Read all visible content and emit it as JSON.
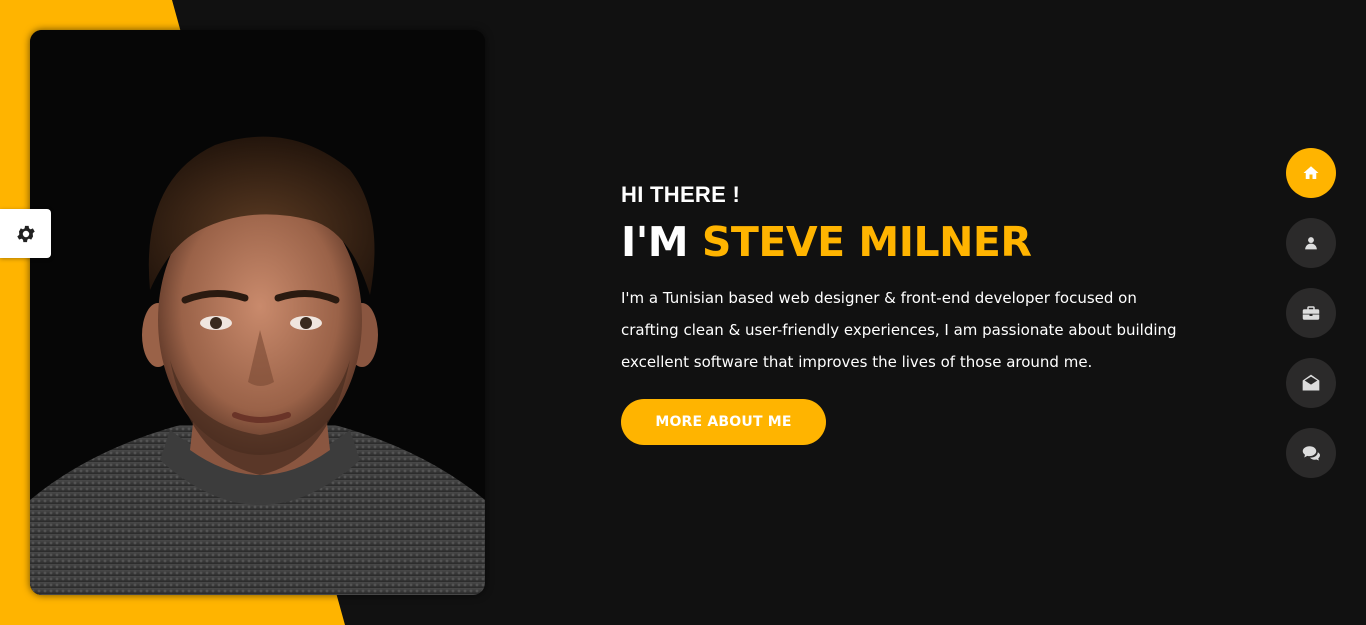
{
  "hero": {
    "greeting": "HI THERE !",
    "headline_prefix": "I'M",
    "headline_name": "STEVE MILNER",
    "bio": "I'm a Tunisian based web designer & front-end developer focused on crafting clean & user-friendly experiences, I am passionate about building excellent software that improves the lives of those around me.",
    "cta_label": "MORE ABOUT ME"
  },
  "portrait": {
    "alt": "Portrait photo"
  },
  "settings": {
    "icon": "gear-icon"
  },
  "nav": {
    "items": [
      {
        "icon": "home-icon",
        "active": true
      },
      {
        "icon": "user-icon",
        "active": false
      },
      {
        "icon": "briefcase-icon",
        "active": false
      },
      {
        "icon": "envelope-open-icon",
        "active": false
      },
      {
        "icon": "comments-icon",
        "active": false
      }
    ]
  },
  "colors": {
    "accent": "#ffb400",
    "background": "#111111",
    "nav_inactive": "#2b2a2a",
    "text": "#ffffff"
  }
}
